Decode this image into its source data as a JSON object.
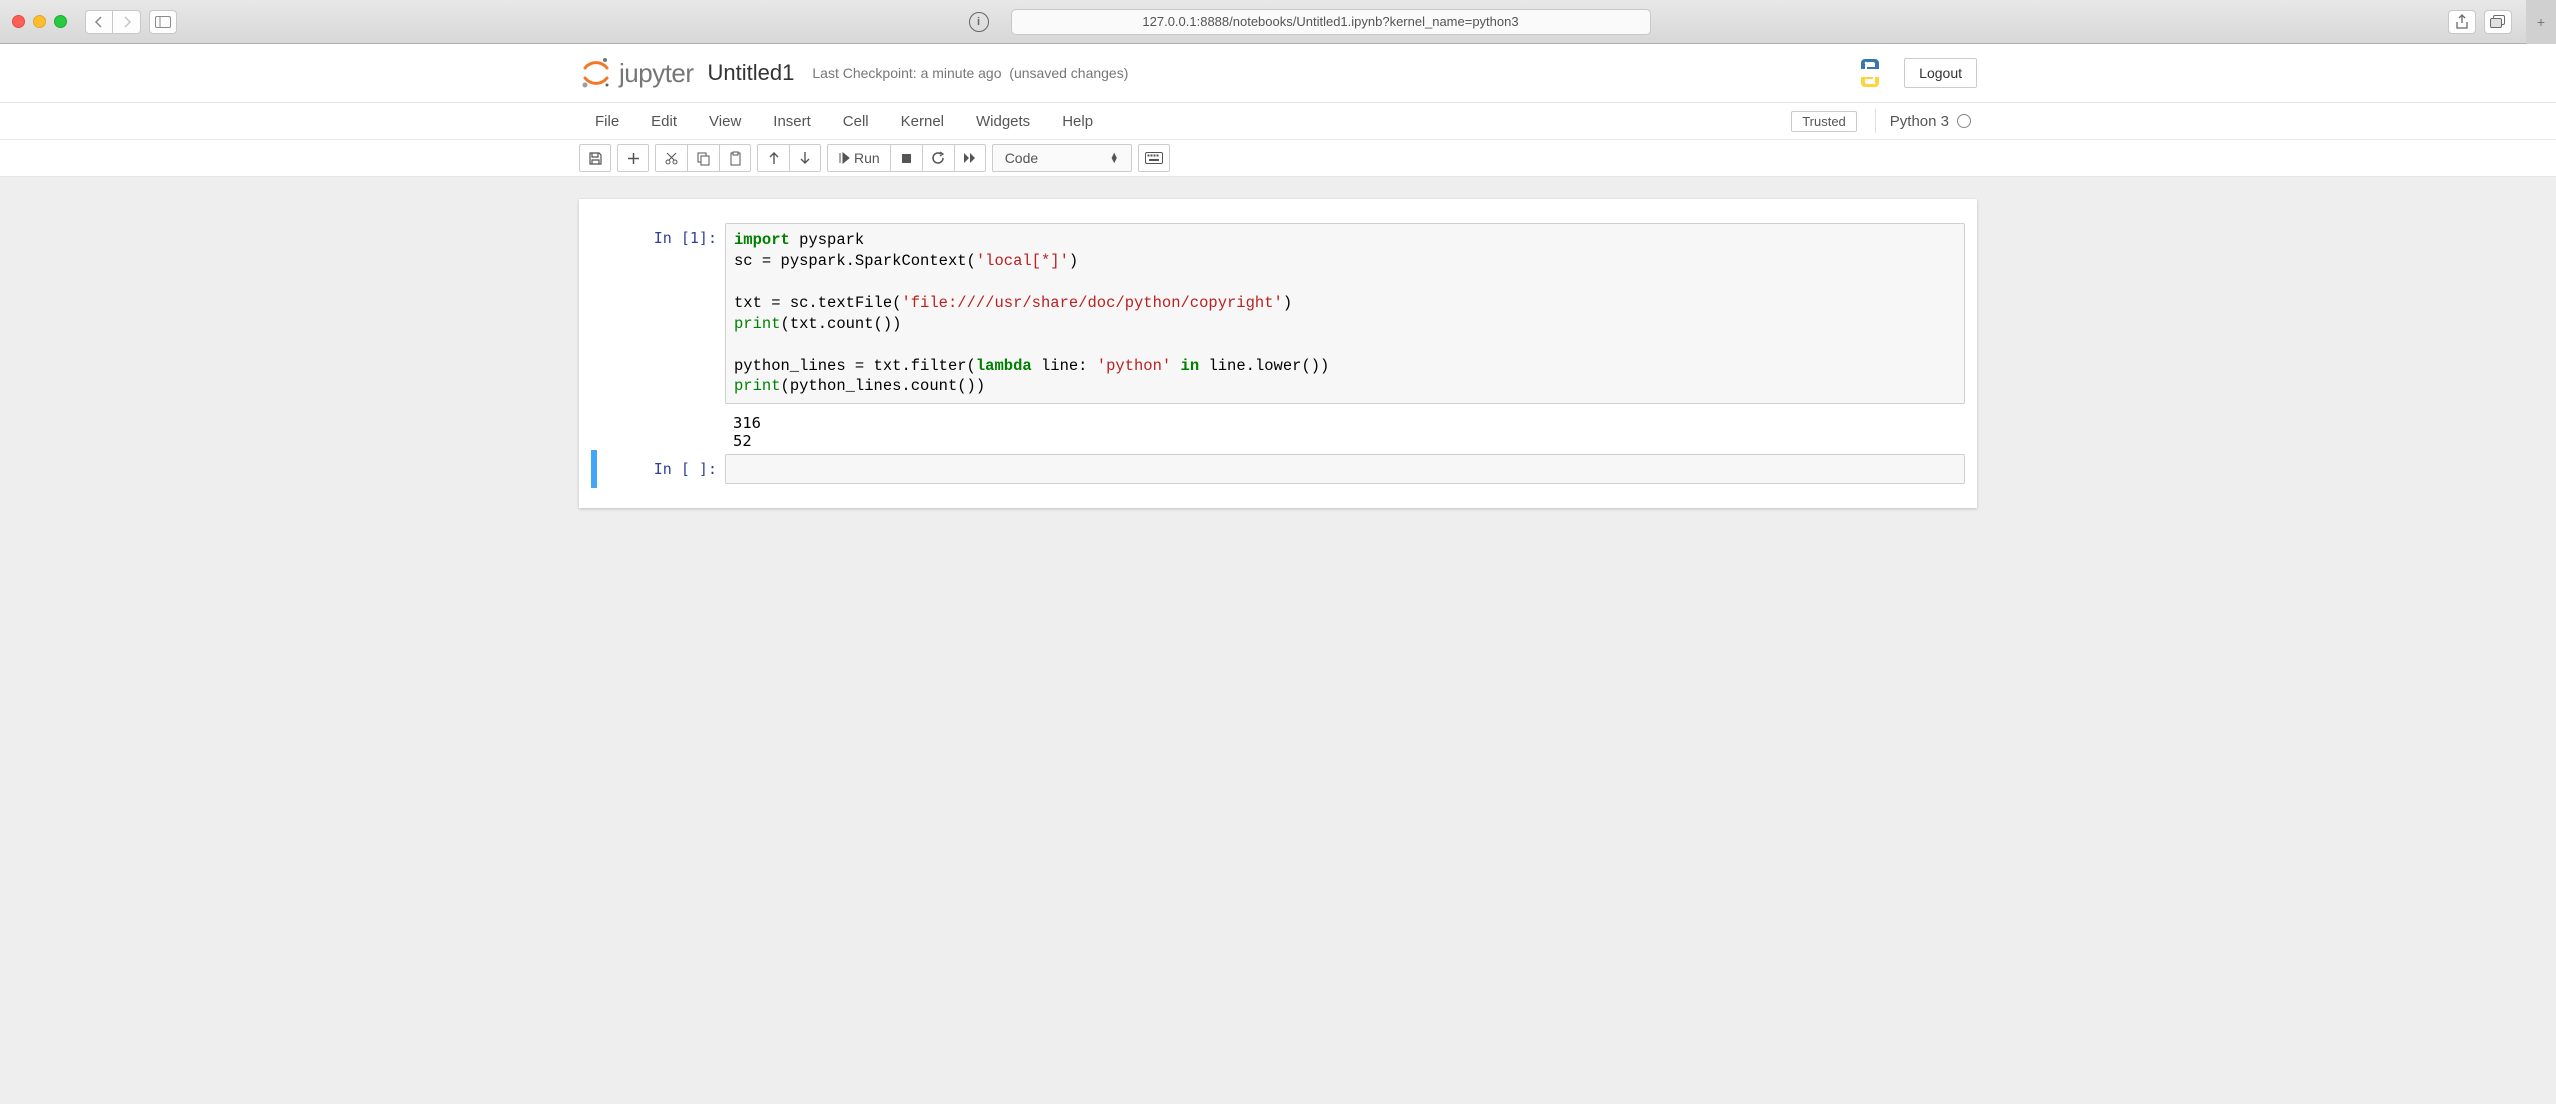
{
  "browser": {
    "url": "127.0.0.1:8888/notebooks/Untitled1.ipynb?kernel_name=python3"
  },
  "header": {
    "logo_text": "jupyter",
    "notebook_name": "Untitled1",
    "checkpoint": "Last Checkpoint: a minute ago",
    "autosave": "(unsaved changes)",
    "logout_label": "Logout"
  },
  "menu": {
    "items": [
      "File",
      "Edit",
      "View",
      "Insert",
      "Cell",
      "Kernel",
      "Widgets",
      "Help"
    ],
    "trusted_label": "Trusted",
    "kernel_label": "Python 3"
  },
  "toolbar": {
    "run_label": "Run",
    "cell_type": "Code"
  },
  "cells": [
    {
      "prompt": "In [1]:",
      "code_tokens": [
        {
          "t": "import",
          "c": "k-keyword"
        },
        {
          "t": " pyspark\n",
          "c": "k-normal"
        },
        {
          "t": "sc ",
          "c": "k-normal"
        },
        {
          "t": "=",
          "c": "k-normal"
        },
        {
          "t": " pyspark.SparkContext(",
          "c": "k-normal"
        },
        {
          "t": "'local[*]'",
          "c": "k-string"
        },
        {
          "t": ")\n\n",
          "c": "k-normal"
        },
        {
          "t": "txt ",
          "c": "k-normal"
        },
        {
          "t": "=",
          "c": "k-normal"
        },
        {
          "t": " sc.textFile(",
          "c": "k-normal"
        },
        {
          "t": "'file:////usr/share/doc/python/copyright'",
          "c": "k-string"
        },
        {
          "t": ")\n",
          "c": "k-normal"
        },
        {
          "t": "print",
          "c": "k-builtin"
        },
        {
          "t": "(txt.count())\n\n",
          "c": "k-normal"
        },
        {
          "t": "python_lines ",
          "c": "k-normal"
        },
        {
          "t": "=",
          "c": "k-normal"
        },
        {
          "t": " txt.filter(",
          "c": "k-normal"
        },
        {
          "t": "lambda",
          "c": "k-keyword"
        },
        {
          "t": " line: ",
          "c": "k-normal"
        },
        {
          "t": "'python'",
          "c": "k-string"
        },
        {
          "t": " ",
          "c": "k-normal"
        },
        {
          "t": "in",
          "c": "k-keyword"
        },
        {
          "t": " line.lower())\n",
          "c": "k-normal"
        },
        {
          "t": "print",
          "c": "k-builtin"
        },
        {
          "t": "(python_lines.count())",
          "c": "k-normal"
        }
      ],
      "output": "316\n52"
    },
    {
      "prompt": "In [ ]:",
      "code_tokens": [],
      "output": null,
      "selected": true
    }
  ]
}
